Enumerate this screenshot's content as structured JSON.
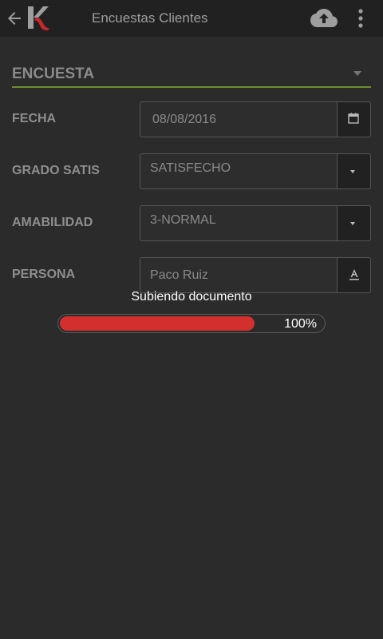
{
  "appbar": {
    "title": "Encuestas Clientes",
    "back_icon": "arrow-left-icon",
    "logo_icon": "app-logo-k",
    "upload_icon": "cloud-upload-icon",
    "menu_icon": "more-vertical-icon"
  },
  "section": {
    "title": "ENCUESTA",
    "caret_icon": "caret-down-icon"
  },
  "fields": {
    "fecha": {
      "label": "FECHA",
      "value": "08/08/2016",
      "icon": "calendar-icon"
    },
    "grado_satis": {
      "label": "GRADO SATIS",
      "value": "SATISFECHO",
      "icon": "caret-down-icon"
    },
    "amabilidad": {
      "label": "AMABILIDAD",
      "value": "3-NORMAL",
      "icon": "caret-down-icon"
    },
    "persona": {
      "label": "PERSONA",
      "value": "Paco Ruiz",
      "icon": "text-field-icon"
    }
  },
  "upload_progress": {
    "label": "Subiendo documento",
    "percent_text": "100%",
    "fill_fraction": 0.74
  },
  "colors": {
    "background": "#2b2b2b",
    "appbar": "#212121",
    "accent_underline": "#6e8b2f",
    "progress_fill": "#d32f2f"
  }
}
